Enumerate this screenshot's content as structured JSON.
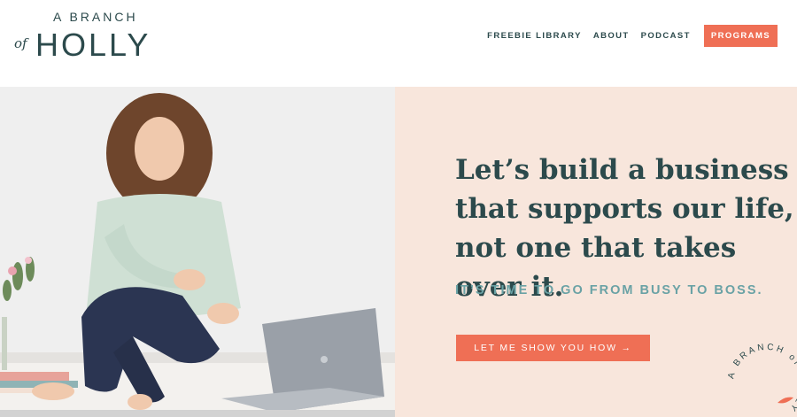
{
  "logo": {
    "top_text": "A BRANCH",
    "of_text": "of",
    "main_text": "HOLLY"
  },
  "nav": {
    "items": [
      {
        "label": "FREEBIE LIBRARY"
      },
      {
        "label": "ABOUT"
      },
      {
        "label": "PODCAST"
      }
    ],
    "cta_label": "PROGRAMS"
  },
  "hero": {
    "headline": "Let’s build a business that supports our life, not one that takes over it.",
    "subhead": "IT’S TIME TO GO FROM BUSY TO BOSS.",
    "cta_label": "LET ME SHOW YOU HOW →",
    "badge_text": "A BRANCH of HOLLY"
  },
  "colors": {
    "brand_teal": "#2c4a4c",
    "accent_coral": "#ef6f55",
    "subhead_teal": "#6aa2a5",
    "panel_peach": "#f8e6dc"
  }
}
